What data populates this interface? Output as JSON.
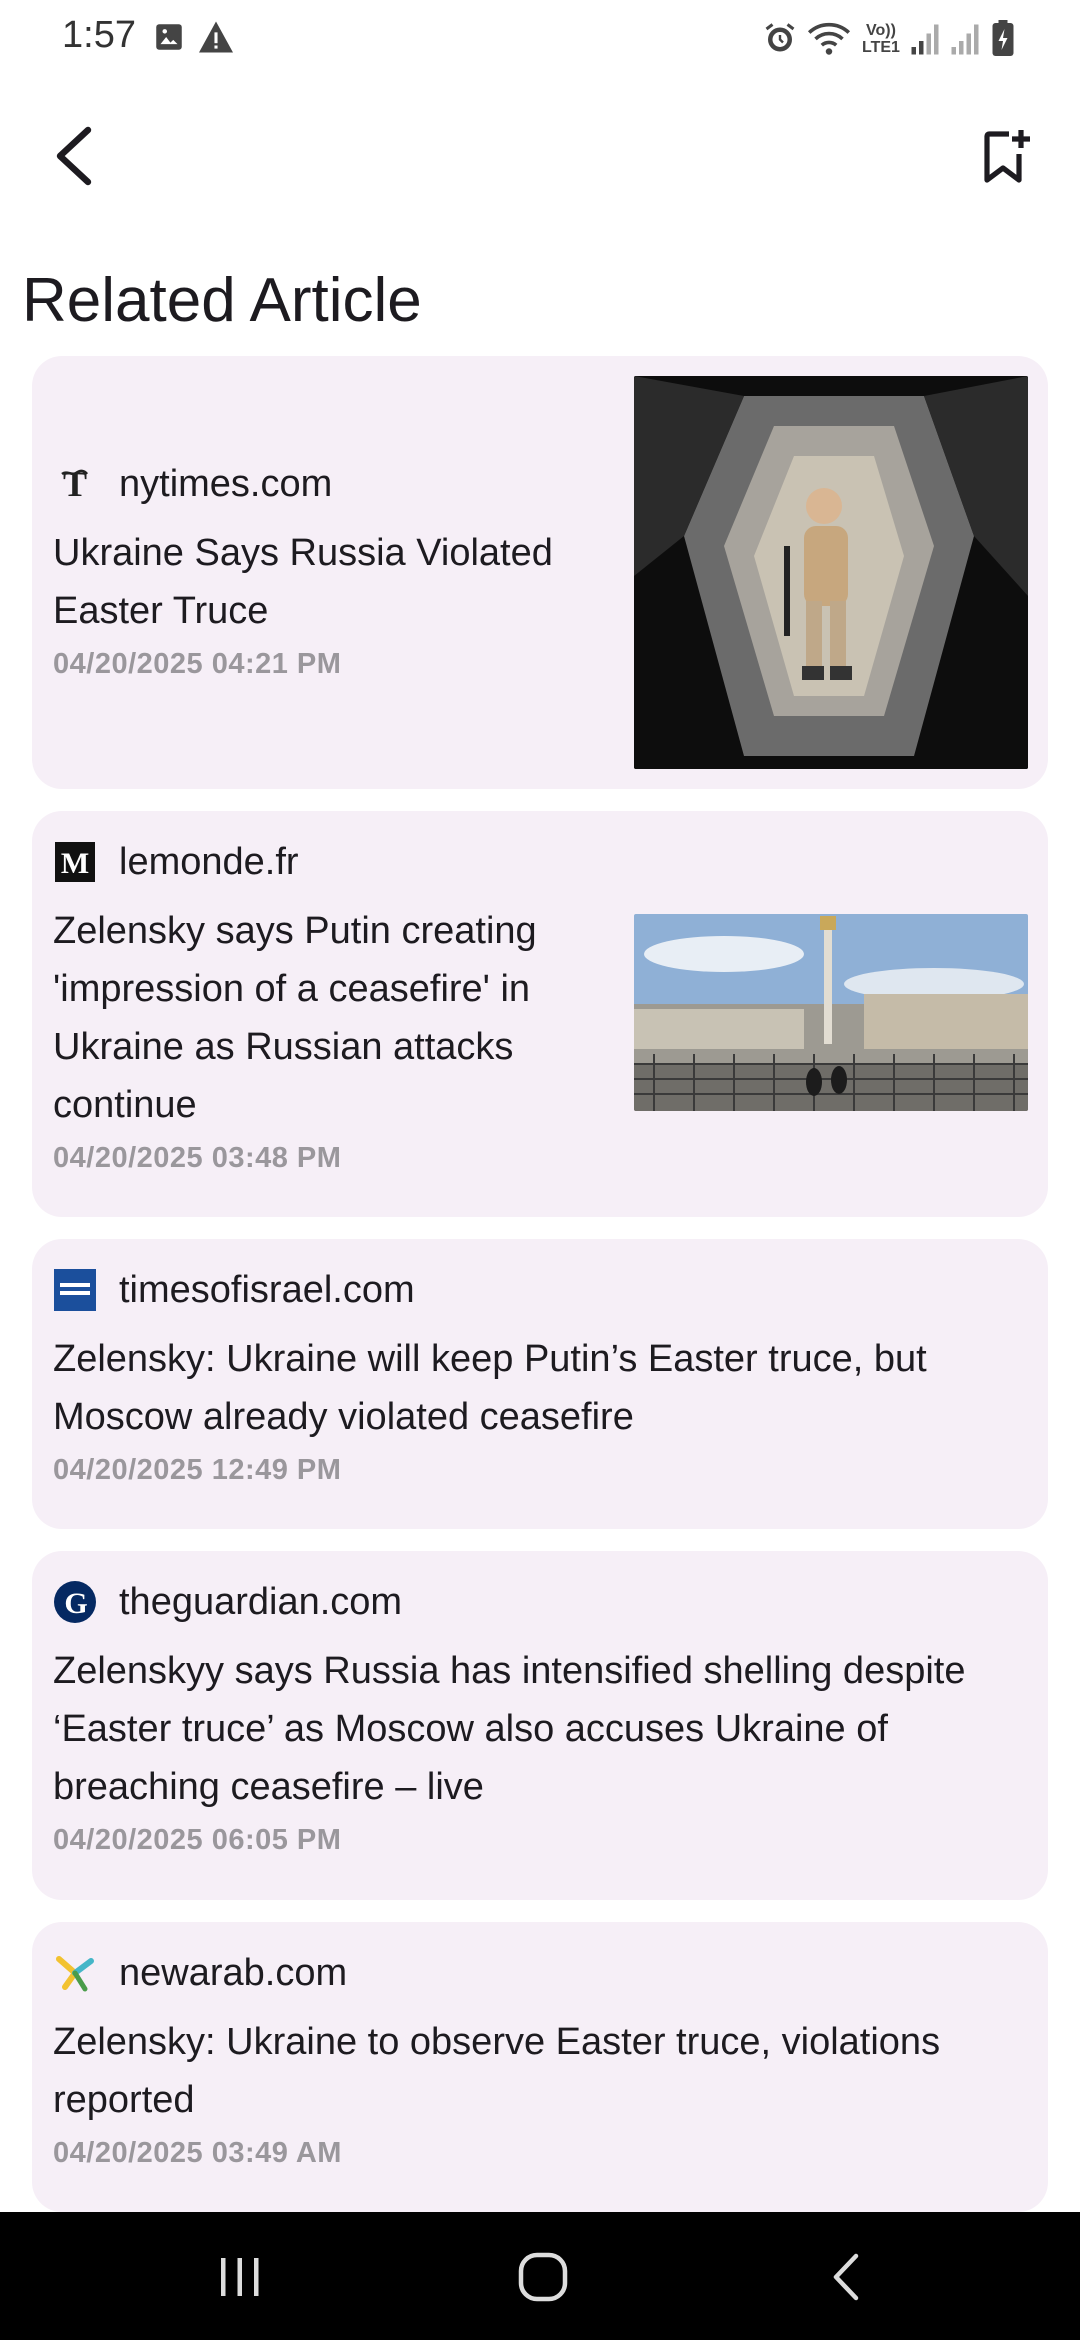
{
  "status_bar": {
    "time": "1:57",
    "icons": [
      "image-icon",
      "warning-icon",
      "alarm-icon",
      "wifi-icon",
      "volte-icon",
      "signal-icon",
      "signal-icon",
      "battery-icon"
    ],
    "volte_label": "Vo))",
    "lte_label": "LTE1"
  },
  "app_bar": {
    "back_icon": "chevron-left-icon",
    "bookmark_icon": "bookmark-add-icon"
  },
  "page": {
    "title": "Related Article"
  },
  "articles": [
    {
      "source": "nytimes.com",
      "favicon": "nyt-logo-icon",
      "headline": "Ukraine Says Russia Violated Easter Truce",
      "date": "04/20/2025 04:21 PM",
      "has_thumbnail": true
    },
    {
      "source": "lemonde.fr",
      "favicon": "lemonde-logo-icon",
      "headline": "Zelensky says Putin creating 'impression of a ceasefire' in Ukraine as Russian attacks continue",
      "date": "04/20/2025 03:48 PM",
      "has_thumbnail": true
    },
    {
      "source": "timesofisrael.com",
      "favicon": "timesofisrael-logo-icon",
      "headline": "Zelensky: Ukraine will keep Putin’s Easter truce, but Moscow already violated ceasefire",
      "date": "04/20/2025 12:49 PM",
      "has_thumbnail": false
    },
    {
      "source": "theguardian.com",
      "favicon": "guardian-logo-icon",
      "headline": "Zelenskyy says Russia has intensified shelling despite ‘Easter truce’ as Moscow also accuses Ukraine of breaching ceasefire – live",
      "date": "04/20/2025 06:05 PM",
      "has_thumbnail": false
    },
    {
      "source": "newarab.com",
      "favicon": "newarab-logo-icon",
      "headline": "Zelensky: Ukraine to observe Easter truce, violations reported",
      "date": "04/20/2025 03:49 AM",
      "has_thumbnail": false
    }
  ],
  "colors": {
    "card_background": "#f6eff7",
    "date_text": "#9a979c",
    "nav_bar": "#000000"
  },
  "nav_bar": {
    "buttons": [
      "recent-apps-icon",
      "home-icon",
      "back-icon"
    ]
  }
}
